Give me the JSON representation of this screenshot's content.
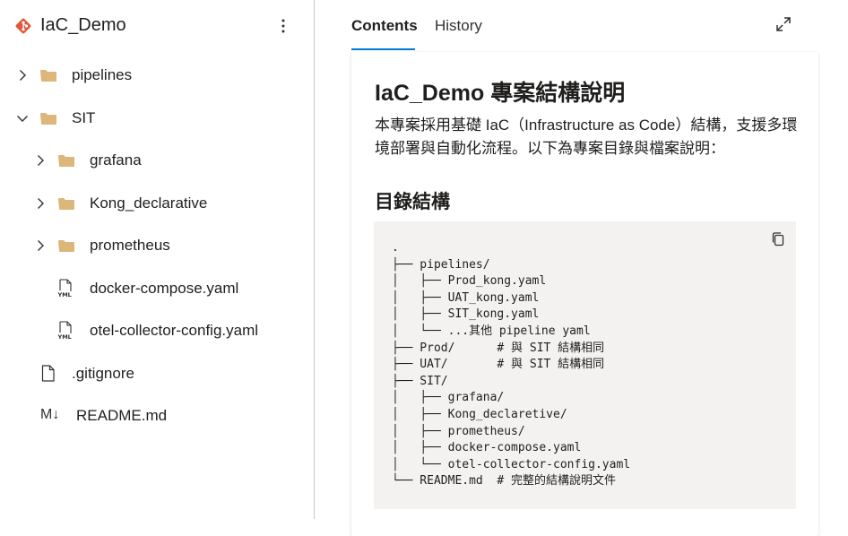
{
  "repo": {
    "name": "IaC_Demo",
    "logo_icon": "azure-repos-icon",
    "logo_color": "#e0593b",
    "more_icon": "more-vertical-icon",
    "more_label": "⋮"
  },
  "tree": [
    {
      "label": "pipelines",
      "type": "folder",
      "expanded": false
    },
    {
      "label": "SIT",
      "type": "folder",
      "expanded": true
    },
    {
      "label": "grafana",
      "type": "folder",
      "expanded": false
    },
    {
      "label": "Kong_declarative",
      "type": "folder",
      "expanded": false
    },
    {
      "label": "prometheus",
      "type": "folder",
      "expanded": false
    },
    {
      "label": "docker-compose.yaml",
      "type": "yaml"
    },
    {
      "label": "otel-collector-config.yaml",
      "type": "yaml"
    },
    {
      "label": ".gitignore",
      "type": "file"
    },
    {
      "label": "README.md",
      "type": "markdown",
      "icon_text": "M↓"
    }
  ],
  "tabs": [
    {
      "label": "Contents",
      "active": true
    },
    {
      "label": "History",
      "active": false
    }
  ],
  "expand_icon": "expand-icon",
  "doc": {
    "title": "IaC_Demo 專案結構說明",
    "intro": "本專案採用基礎 IaC（Infrastructure as Code）結構，支援多環境部署與自動化流程。以下為專案目錄與檔案說明：",
    "section_heading": "目錄結構",
    "copy_icon": "copy-icon",
    "code": ".\n├── pipelines/\n│   ├── Prod_kong.yaml\n│   ├── UAT_kong.yaml\n│   ├── SIT_kong.yaml\n│   └── ...其他 pipeline yaml\n├── Prod/      # 與 SIT 結構相同\n├── UAT/       # 與 SIT 結構相同\n├── SIT/\n│   ├── grafana/\n│   ├── Kong_declaretive/\n│   ├── prometheus/\n│   ├── docker-compose.yaml\n│   └── otel-collector-config.yaml\n└── README.md  # 完整的結構說明文件"
  },
  "colors": {
    "accent": "#0078d4",
    "folder": "#dcb67a",
    "code_bg": "#f3f2f1"
  }
}
